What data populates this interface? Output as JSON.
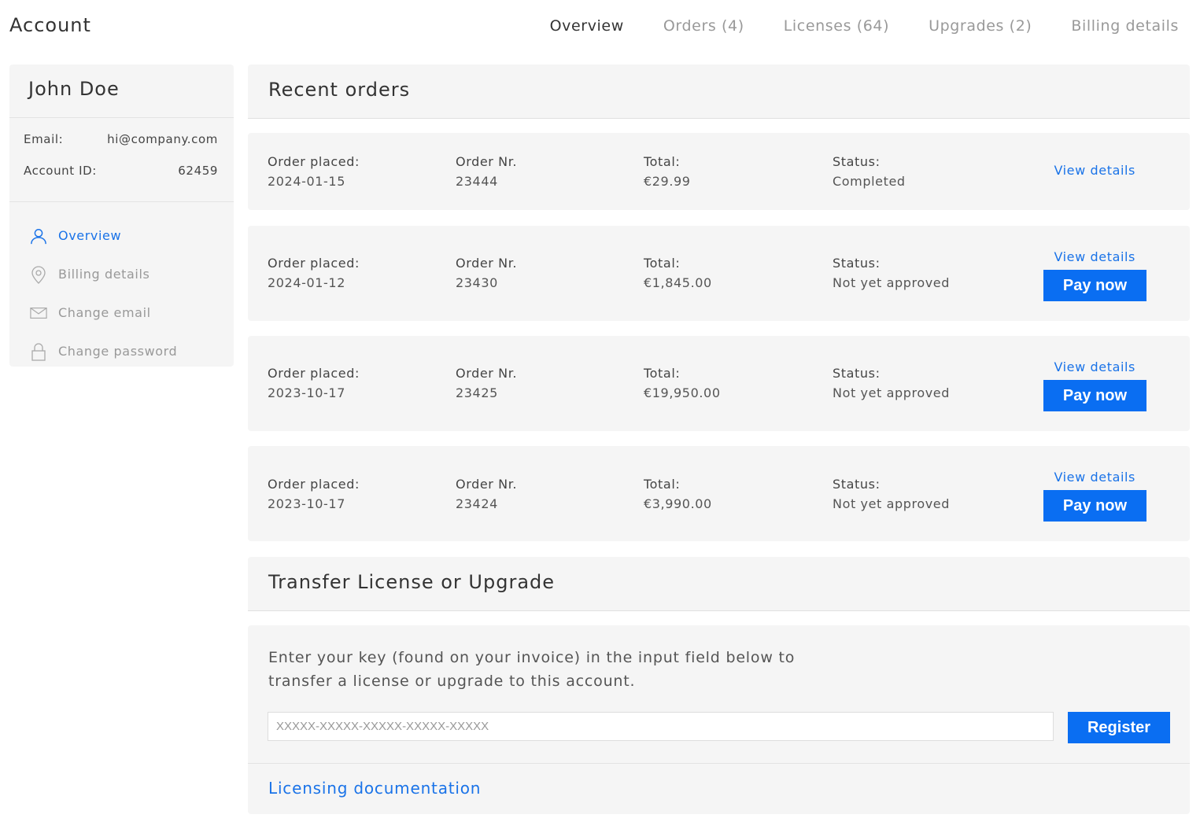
{
  "header": {
    "title": "Account",
    "tabs": [
      {
        "label": "Overview",
        "active": true
      },
      {
        "label": "Orders (4)",
        "active": false
      },
      {
        "label": "Licenses (64)",
        "active": false
      },
      {
        "label": "Upgrades (2)",
        "active": false
      },
      {
        "label": "Billing details",
        "active": false
      }
    ]
  },
  "sidebar": {
    "name": "John Doe",
    "email_label": "Email:",
    "email_value": "hi@company.com",
    "account_id_label": "Account ID:",
    "account_id_value": "62459",
    "nav": [
      {
        "label": "Overview",
        "icon": "user-icon",
        "active": true
      },
      {
        "label": "Billing details",
        "icon": "location-pin-icon",
        "active": false
      },
      {
        "label": "Change email",
        "icon": "envelope-icon",
        "active": false
      },
      {
        "label": "Change password",
        "icon": "lock-icon",
        "active": false
      }
    ]
  },
  "recent_orders": {
    "title": "Recent orders",
    "labels": {
      "placed": "Order placed:",
      "number": "Order Nr.",
      "total": "Total:",
      "status": "Status:",
      "view": "View details",
      "pay": "Pay now"
    },
    "orders": [
      {
        "placed": "2024-01-15",
        "number": "23444",
        "total": "€29.99",
        "status": "Completed",
        "payable": false
      },
      {
        "placed": "2024-01-12",
        "number": "23430",
        "total": "€1,845.00",
        "status": "Not yet approved",
        "payable": true
      },
      {
        "placed": "2023-10-17",
        "number": "23425",
        "total": "€19,950.00",
        "status": "Not yet approved",
        "payable": true
      },
      {
        "placed": "2023-10-17",
        "number": "23424",
        "total": "€3,990.00",
        "status": "Not yet approved",
        "payable": true
      }
    ]
  },
  "transfer": {
    "title": "Transfer License or Upgrade",
    "description": "Enter your key (found on your invoice) in the input field below to transfer a license or upgrade to this account.",
    "input_placeholder": "XXXXX-XXXXX-XXXXX-XXXXX-XXXXX",
    "input_value": "",
    "register_label": "Register",
    "doc_link": "Licensing documentation"
  },
  "colors": {
    "accent": "#1a73e8",
    "button": "#0a6ef2",
    "completed": "#3aaa80",
    "panel": "#f5f5f5"
  }
}
